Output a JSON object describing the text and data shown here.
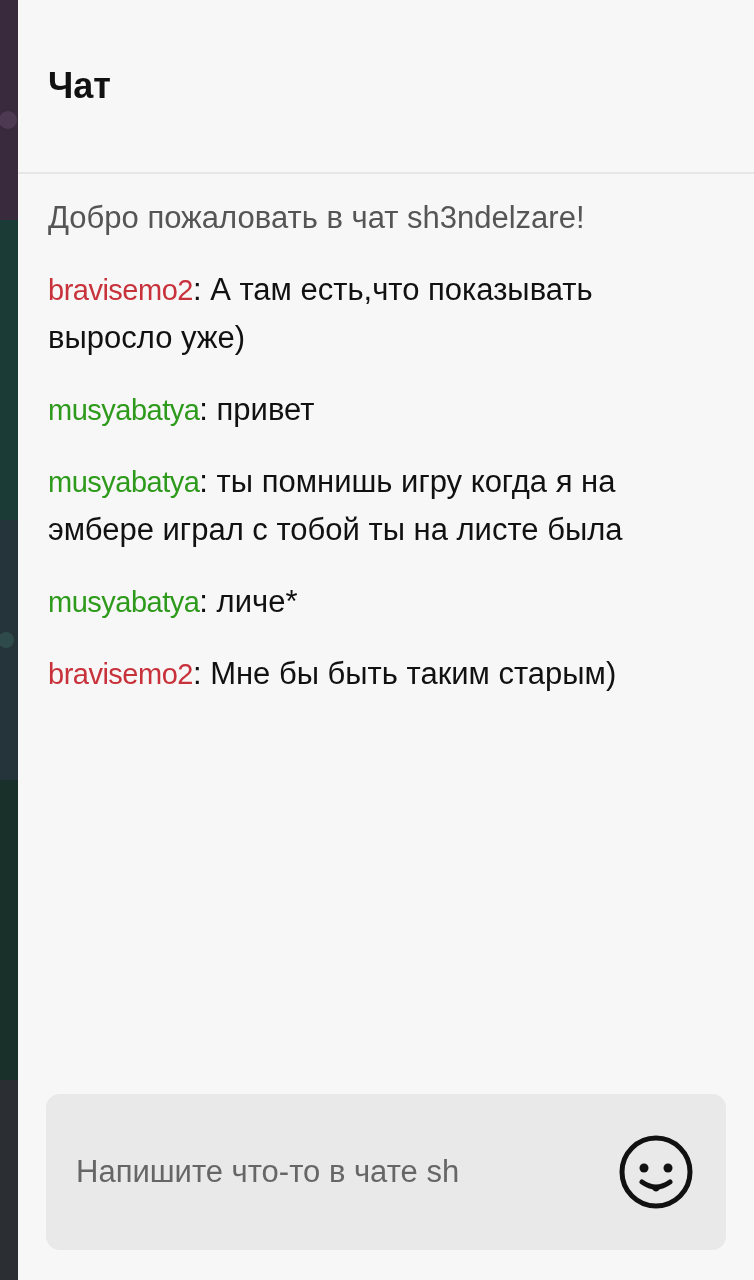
{
  "header": {
    "title": "Чат"
  },
  "messages": [
    {
      "kind": "system",
      "text": "Добро пожаловать в чат sh3ndelzare!"
    },
    {
      "kind": "user",
      "author": "bravisemo2",
      "color": "#c8323a",
      "text": ": А там есть,что показывать выросло уже)"
    },
    {
      "kind": "user",
      "author": "musyabatya",
      "color": "#2e9a1c",
      "text": ": привет"
    },
    {
      "kind": "user",
      "author": "musyabatya",
      "color": "#2e9a1c",
      "text": ": ты помнишь игру когда я на эмбере играл с тобой ты на листе была"
    },
    {
      "kind": "user",
      "author": "musyabatya",
      "color": "#2e9a1c",
      "text": ": личе*"
    },
    {
      "kind": "user",
      "author": "bravisemo2",
      "color": "#c8323a",
      "text": ": Мне бы быть таким старым)"
    }
  ],
  "input": {
    "placeholder": "Напишите что-то в чате sh"
  }
}
